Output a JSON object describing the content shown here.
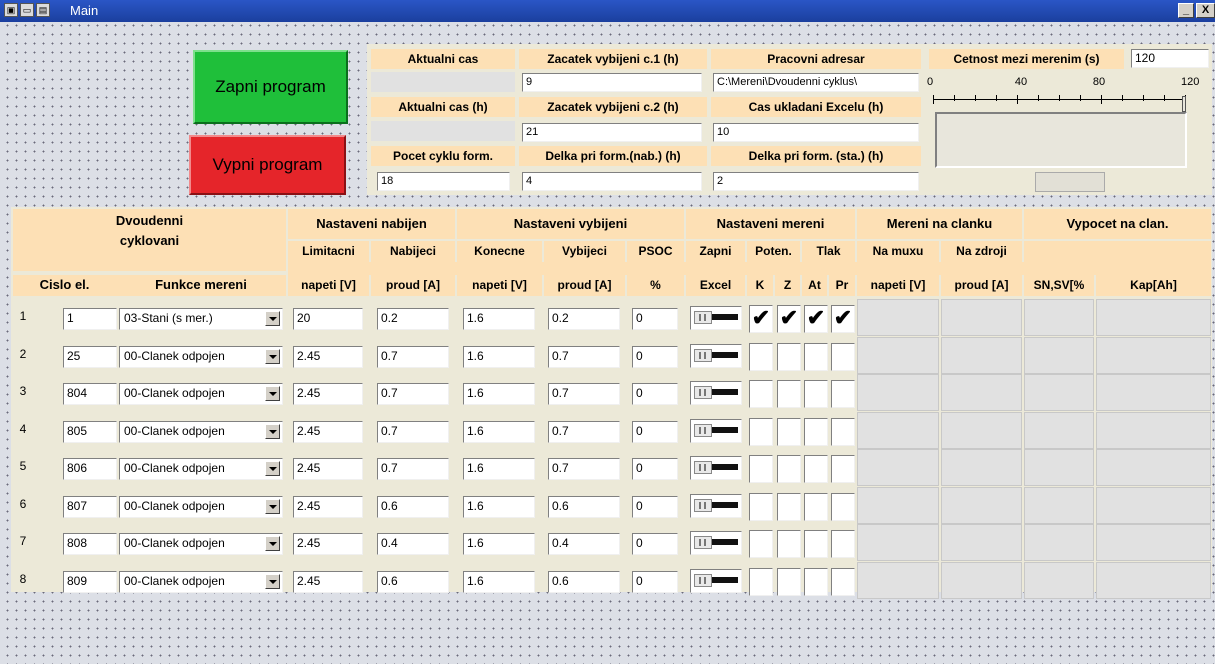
{
  "window": {
    "title": "Main",
    "minimize": "_",
    "close": "X"
  },
  "buttons": {
    "start": "Zapni program",
    "stop": "Vypni program"
  },
  "top": {
    "aktualni_cas": "Aktualni cas",
    "aktualni_cas_h": "Aktualni cas (h)",
    "zacatek1": "Zacatek vybijeni c.1 (h)",
    "zacatek1_val": "9",
    "zacatek2": "Zacatek vybijeni c.2 (h)",
    "zacatek2_val": "21",
    "adresar": "Pracovni adresar",
    "adresar_val": "C:\\Mereni\\Dvoudenni cyklus\\",
    "excel": "Cas ukladani Excelu (h)",
    "excel_val": "10",
    "pocet": "Pocet cyklu form.",
    "pocet_val": "18",
    "delka_nab": "Delka pri form.(nab.) (h)",
    "delka_nab_val": "4",
    "delka_sta": "Delka pri form. (sta.) (h)",
    "delka_sta_val": "2",
    "cetnost": "Cetnost mezi merenim (s)",
    "cetnost_val": "120",
    "slider_ticks": [
      "0",
      "40",
      "80",
      "120"
    ],
    "slider_value": 120
  },
  "table": {
    "groups": {
      "dvoudenni": "Dvoudenni",
      "cyklovani": "cyklovani",
      "nabijen": "Nastaveni nabijen",
      "vybijeni": "Nastaveni vybijeni",
      "mereni": "Nastaveni mereni",
      "clanku": "Mereni na clanku",
      "vypocet": "Vypocet na clan."
    },
    "sub1": {
      "limitacni": "Limitacni",
      "nabijeci": "Nabijeci",
      "konecne": "Konecne",
      "vybijeci": "Vybijeci",
      "psoc": "PSOC",
      "zapni": "Zapni",
      "poten": "Poten.",
      "tlak": "Tlak",
      "na_muxu": "Na muxu",
      "na_zdroji": "Na zdroji"
    },
    "sub2": {
      "cislo": "Cislo el.",
      "funkce": "Funkce mereni",
      "napeti1": "napeti [V]",
      "proud1": "proud [A]",
      "napeti2": "napeti [V]",
      "proud2": "proud [A]",
      "pct": "%",
      "excel": "Excel",
      "k": "K",
      "z": "Z",
      "at": "At",
      "pr": "Pr",
      "napeti3": "napeti [V]",
      "proud3": "proud [A]",
      "snsv": "SN,SV[%",
      "kap": "Kap[Ah]"
    },
    "rows": [
      {
        "n": "1",
        "cislo": "1",
        "funkce": "03-Stani (s mer.)",
        "lim": "20",
        "nab": "0.2",
        "kon": "1.6",
        "vyb": "0.2",
        "psoc": "0",
        "k": "✔",
        "z": "✔",
        "at": "✔",
        "pr": "✔"
      },
      {
        "n": "2",
        "cislo": "25",
        "funkce": "00-Clanek odpojen",
        "lim": "2.45",
        "nab": "0.7",
        "kon": "1.6",
        "vyb": "0.7",
        "psoc": "0",
        "k": "",
        "z": "",
        "at": "",
        "pr": ""
      },
      {
        "n": "3",
        "cislo": "804",
        "funkce": "00-Clanek odpojen",
        "lim": "2.45",
        "nab": "0.7",
        "kon": "1.6",
        "vyb": "0.7",
        "psoc": "0",
        "k": "",
        "z": "",
        "at": "",
        "pr": ""
      },
      {
        "n": "4",
        "cislo": "805",
        "funkce": "00-Clanek odpojen",
        "lim": "2.45",
        "nab": "0.7",
        "kon": "1.6",
        "vyb": "0.7",
        "psoc": "0",
        "k": "",
        "z": "",
        "at": "",
        "pr": ""
      },
      {
        "n": "5",
        "cislo": "806",
        "funkce": "00-Clanek odpojen",
        "lim": "2.45",
        "nab": "0.7",
        "kon": "1.6",
        "vyb": "0.7",
        "psoc": "0",
        "k": "",
        "z": "",
        "at": "",
        "pr": ""
      },
      {
        "n": "6",
        "cislo": "807",
        "funkce": "00-Clanek odpojen",
        "lim": "2.45",
        "nab": "0.6",
        "kon": "1.6",
        "vyb": "0.6",
        "psoc": "0",
        "k": "",
        "z": "",
        "at": "",
        "pr": ""
      },
      {
        "n": "7",
        "cislo": "808",
        "funkce": "00-Clanek odpojen",
        "lim": "2.45",
        "nab": "0.4",
        "kon": "1.6",
        "vyb": "0.4",
        "psoc": "0",
        "k": "",
        "z": "",
        "at": "",
        "pr": ""
      },
      {
        "n": "8",
        "cislo": "809",
        "funkce": "00-Clanek odpojen",
        "lim": "2.45",
        "nab": "0.6",
        "kon": "1.6",
        "vyb": "0.6",
        "psoc": "0",
        "k": "",
        "z": "",
        "at": "",
        "pr": ""
      }
    ]
  }
}
